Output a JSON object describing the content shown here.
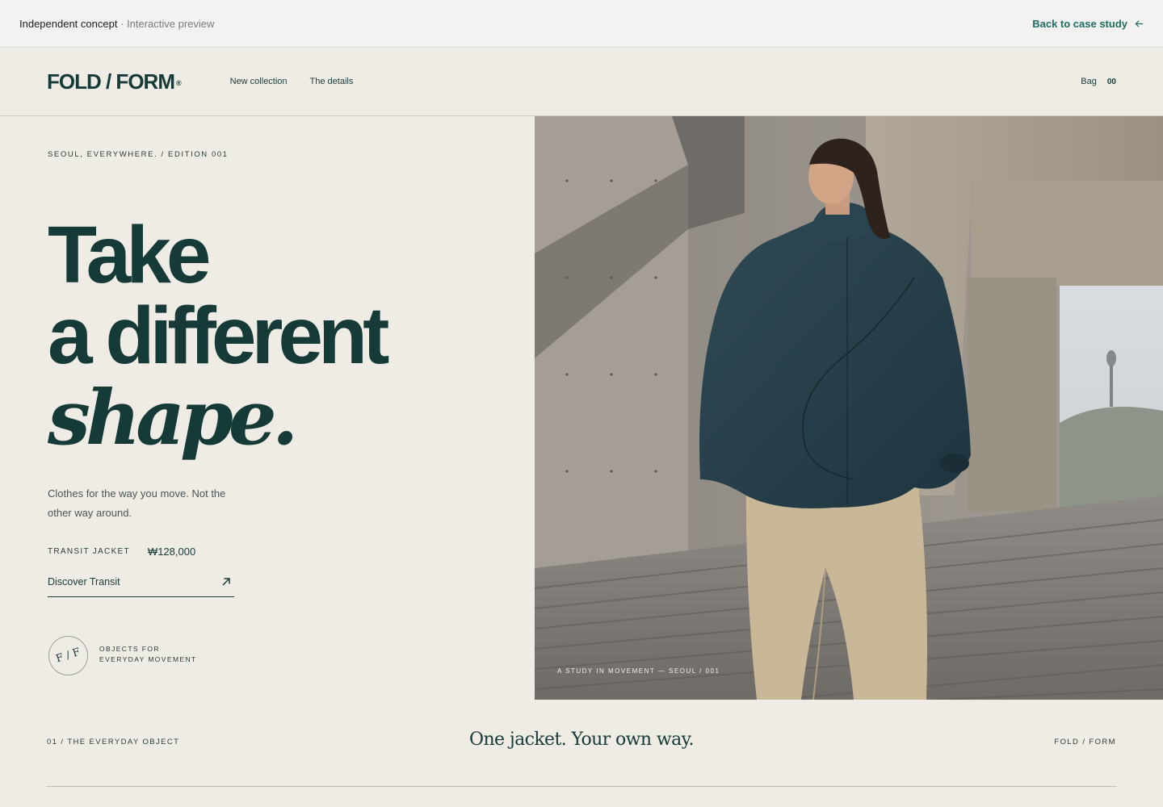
{
  "preview_bar": {
    "concept": "Independent concept",
    "separator": "·",
    "mode": "Interactive preview",
    "back_label": "Back to case study",
    "back_icon": "arrow-left-icon"
  },
  "header": {
    "logo": "FOLD / FORM",
    "logo_mark": "®",
    "nav": [
      {
        "label": "New collection"
      },
      {
        "label": "The details"
      }
    ],
    "bag_label": "Bag",
    "bag_count": "00"
  },
  "hero": {
    "eyebrow": "SEOUL, EVERYWHERE. / EDITION 001",
    "headline": {
      "line1": "Take",
      "line2": "a different",
      "line3": "shape."
    },
    "tagline": "Clothes for the way you move. Not the other way around.",
    "product_name": "TRANSIT JACKET",
    "price": "₩128,000",
    "cta_label": "Discover Transit",
    "cta_icon": "arrow-up-right-icon",
    "seal_text": "F / F",
    "seal_caption_line1": "OBJECTS FOR",
    "seal_caption_line2": "EVERYDAY MOVEMENT",
    "image_caption": "A STUDY IN MOVEMENT — SEOUL / 001"
  },
  "section": {
    "label": "01 / THE EVERYDAY OBJECT",
    "title": "One jacket. Your own way.",
    "brand": "FOLD / FORM"
  },
  "colors": {
    "background": "#efece5",
    "ink": "#163a37",
    "accent": "#1f6b64",
    "jacket": "#27414a",
    "trousers": "#c9b898"
  }
}
